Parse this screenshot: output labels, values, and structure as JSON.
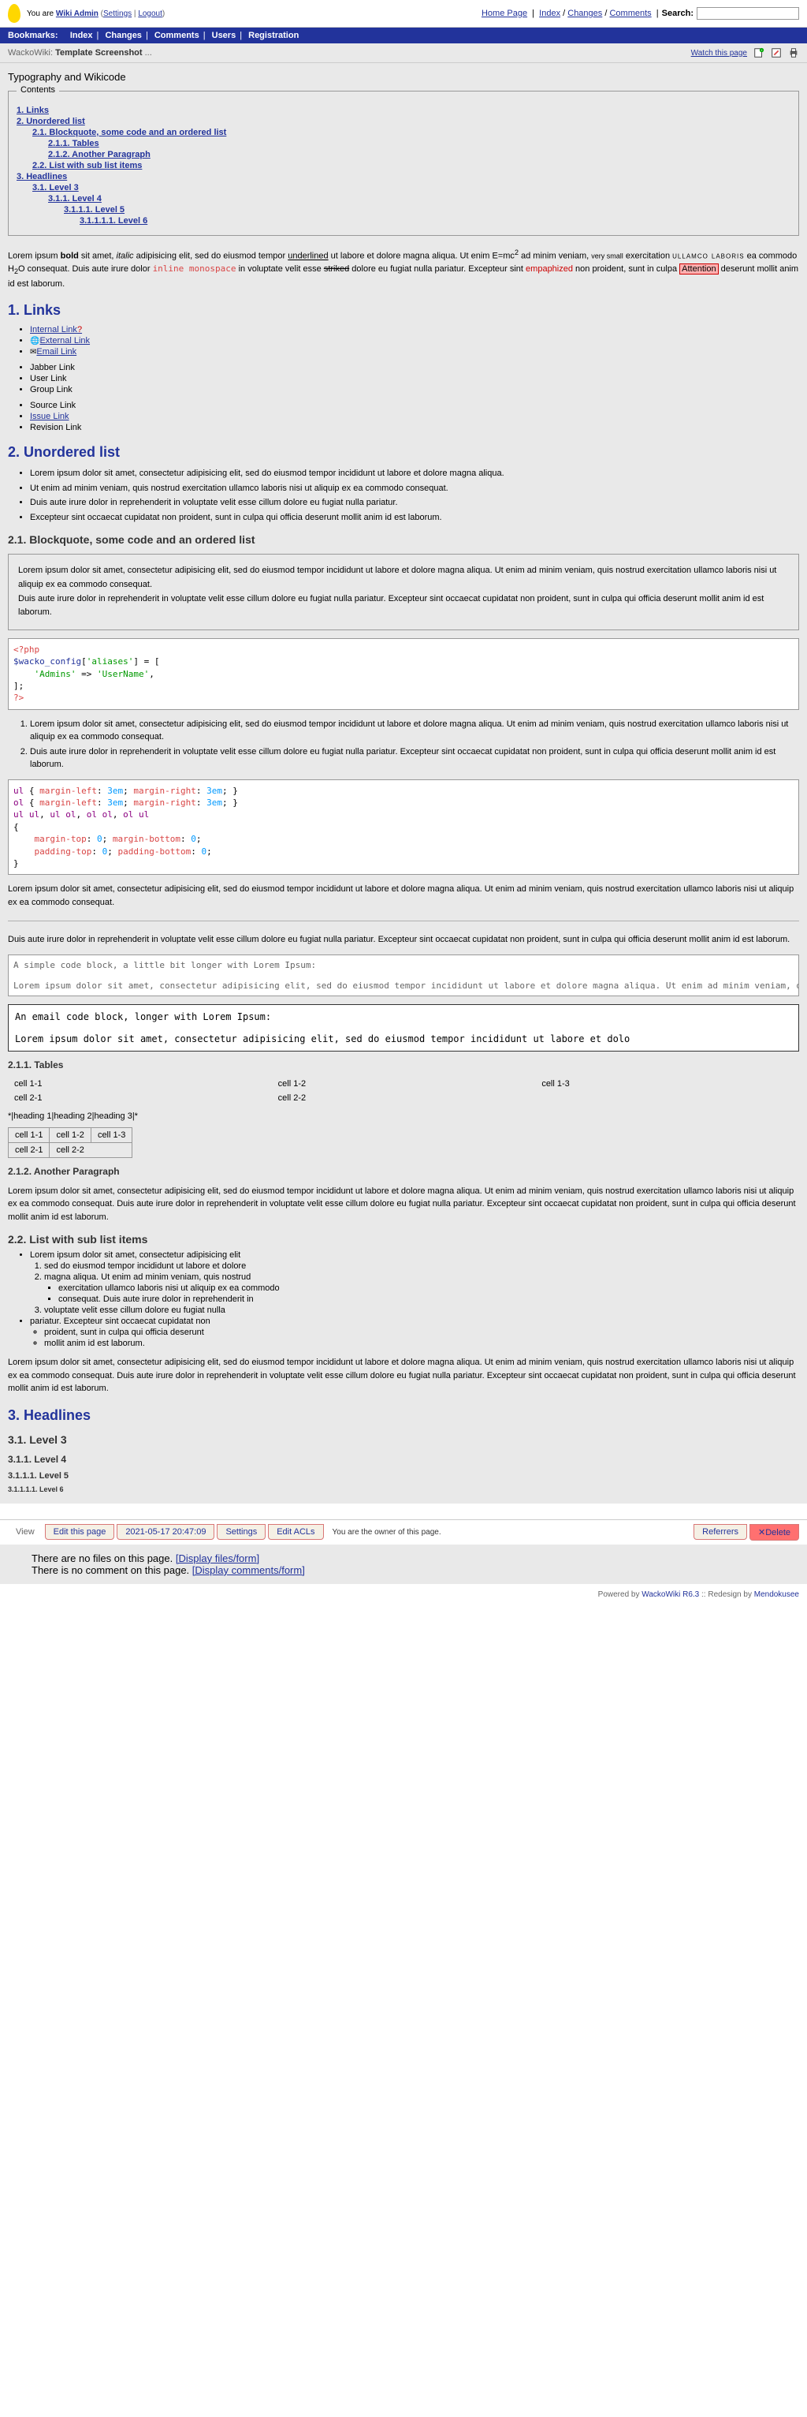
{
  "header": {
    "user_prefix": "You are",
    "user_name": "Wiki Admin",
    "account": "Settings",
    "logout": "Logout",
    "home": "Home Page",
    "index": "Index",
    "changes": "Changes",
    "comments": "Comments",
    "search_label": "Search:"
  },
  "bookmarks": {
    "label": "Bookmarks:",
    "items": [
      "Index",
      "Changes",
      "Comments",
      "Users",
      "Registration"
    ]
  },
  "page": {
    "wiki_name": "WackoWiki:",
    "title": "Template Screenshot",
    "dots": "...",
    "watch": "Watch this page",
    "heading": "Typography and Wikicode"
  },
  "toc": {
    "legend": "Contents",
    "l1": "1. Links",
    "l2": "2. Unordered list",
    "l21": "2.1. Blockquote, some code and an ordered list",
    "l211": "2.1.1. Tables",
    "l212": "2.1.2. Another Paragraph",
    "l22": "2.2. List with sub list items",
    "l3": "3. Headlines",
    "l31": "3.1. Level 3",
    "l311": "3.1.1. Level 4",
    "l3111": "3.1.1.1. Level 5",
    "l31111": "3.1.1.1.1. Level 6"
  },
  "intro": {
    "p1": "Lorem ipsum ",
    "bold": "bold",
    "p2": " sit amet, ",
    "italic": "italic",
    "p3": " adipisicing elit, sed do eiusmod tempor ",
    "underline": "underlined",
    "p4": " ut labore et dolore magna aliqua. Ut enim E=mc",
    "sup": "2",
    "p5": " ad minim veniam, ",
    "small": "very small",
    "p6": " exercitation ",
    "caps": "ullamco laboris",
    "p7": " ea commodo H",
    "sub": "2",
    "p8": "O consequat. Duis aute irure dolor ",
    "mono": "inline monospace",
    "p9": " in voluptate velit esse ",
    "strike": "striked",
    "p10": " dolore eu fugiat nulla pariatur. Excepteur sint ",
    "red": "empaphized",
    "p11": " non proident, sunt in culpa ",
    "highlight": "Attention",
    "p12": " deserunt mollit anim id est laborum."
  },
  "sections": {
    "links": "1. Links",
    "unordered": "2. Unordered list",
    "blockquote": "2.1. Blockquote, some code and an ordered list",
    "tables": "2.1.1. Tables",
    "another": "2.1.2. Another Paragraph",
    "sublist": "2.2. List with sub list items",
    "headlines": "3. Headlines",
    "level3": "3.1. Level 3",
    "level4": "3.1.1. Level 4",
    "level5": "3.1.1.1. Level 5",
    "level6": "3.1.1.1.1. Level 6"
  },
  "links": {
    "internal": "Internal Link",
    "external": "External Link",
    "email": "Email Link",
    "jabber": "Jabber Link",
    "user": "User Link",
    "group": "Group Link",
    "source": "Source Link",
    "issue": "Issue Link",
    "revision": "Revision Link"
  },
  "ul_items": {
    "i1": "Lorem ipsum dolor sit amet, consectetur adipisicing elit, sed do eiusmod tempor incididunt ut labore et dolore magna aliqua.",
    "i2": "Ut enim ad minim veniam, quis nostrud exercitation ullamco laboris nisi ut aliquip ex ea commodo consequat.",
    "i3": "Duis aute irure dolor in reprehenderit in voluptate velit esse cillum dolore eu fugiat nulla pariatur.",
    "i4": "Excepteur sint occaecat cupidatat non proident, sunt in culpa qui officia deserunt mollit anim id est laborum."
  },
  "blockquote": {
    "p1": "Lorem ipsum dolor sit amet, consectetur adipisicing elit, sed do eiusmod tempor incididunt ut labore et dolore magna aliqua. Ut enim ad minim veniam, quis nostrud exercitation ullamco laboris nisi ut aliquip ex ea commodo consequat.",
    "p2": "Duis aute irure dolor in reprehenderit in voluptate velit esse cillum dolore eu fugiat nulla pariatur. Excepteur sint occaecat cupidatat non proident, sunt in culpa qui officia deserunt mollit anim id est laborum."
  },
  "code1": "<?php\n$wacko_config['aliases'] = [\n    'Admins' => 'UserName',\n];\n?>",
  "ol_items": {
    "i1": "Lorem ipsum dolor sit amet, consectetur adipisicing elit, sed do eiusmod tempor incididunt ut labore et dolore magna aliqua. Ut enim ad minim veniam, quis nostrud exercitation ullamco laboris nisi ut aliquip ex ea commodo consequat.",
    "i2": "Duis aute irure dolor in reprehenderit in voluptate velit esse cillum dolore eu fugiat nulla pariatur. Excepteur sint occaecat cupidatat non proident, sunt in culpa qui officia deserunt mollit anim id est laborum."
  },
  "code2": "ul { margin-left: 3em; margin-right: 3em; }\nol { margin-left: 3em; margin-right: 3em; }\nul ul, ul ol, ol ol, ol ul\n{\n    margin-top: 0; margin-bottom: 0;\n    padding-top: 0; padding-bottom: 0;\n}",
  "para_after_code": "Lorem ipsum dolor sit amet, consectetur adipisicing elit, sed do eiusmod tempor incididunt ut labore et dolore magna aliqua. Ut enim ad minim veniam, quis nostrud exercitation ullamco laboris nisi ut aliquip ex ea commodo consequat.",
  "para_after_hr": "Duis aute irure dolor in reprehenderit in voluptate velit esse cillum dolore eu fugiat nulla pariatur. Excepteur sint occaecat cupidatat non proident, sunt in culpa qui officia deserunt mollit anim id est laborum.",
  "simple_code": {
    "l1": "A simple code block, a little bit longer with Lorem Ipsum:",
    "l2": "Lorem ipsum dolor sit amet, consectetur adipisicing elit, sed do eiusmod tempor incididunt ut labore et dolore magna aliqua. Ut enim ad minim veniam, quis nostrud exercitation ullamco laboris nisi ut aliquip ex ea commodo"
  },
  "email_code": {
    "l1": "An email code block, longer with Lorem Ipsum:",
    "l2": "Lorem ipsum dolor sit amet, consectetur adipisicing elit, sed do eiusmod tempor incididunt ut labore et dolo"
  },
  "table1": {
    "r1c1": "cell 1-1",
    "r1c2": "cell 1-2",
    "r1c3": "cell 1-3",
    "r2c1": "cell 2-1",
    "r2c2": "cell 2-2"
  },
  "table2_markup": "*|heading 1|heading 2|heading 3|*",
  "table2": {
    "r1c1": "cell 1-1",
    "r1c2": "cell 1-2",
    "r1c3": "cell 1-3",
    "r2c1": "cell 2-1",
    "r2c2": "cell 2-2"
  },
  "another_para": "Lorem ipsum dolor sit amet, consectetur adipisicing elit, sed do eiusmod tempor incididunt ut labore et dolore magna aliqua. Ut enim ad minim veniam, quis nostrud exercitation ullamco laboris nisi ut aliquip ex ea commodo consequat. Duis aute irure dolor in reprehenderit in voluptate velit esse cillum dolore eu fugiat nulla pariatur. Excepteur sint occaecat cupidatat non proident, sunt in culpa qui officia deserunt mollit anim id est laborum.",
  "nested": {
    "i1": "Lorem ipsum dolor sit amet, consectetur adipisicing elit",
    "i1_1": "sed do eiusmod tempor incididunt ut labore et dolore",
    "i1_2": "magna aliqua. Ut enim ad minim veniam, quis nostrud",
    "i1_2_1": "exercitation ullamco laboris nisi ut aliquip ex ea commodo",
    "i1_2_2": "consequat. Duis aute irure dolor in reprehenderit in",
    "i1_3": "voluptate velit esse cillum dolore eu fugiat nulla",
    "i2": "pariatur. Excepteur sint occaecat cupidatat non",
    "i2_1": "proident, sunt in culpa qui officia deserunt",
    "i2_2": "mollit anim id est laborum."
  },
  "final_para": "Lorem ipsum dolor sit amet, consectetur adipisicing elit, sed do eiusmod tempor incididunt ut labore et dolore magna aliqua. Ut enim ad minim veniam, quis nostrud exercitation ullamco laboris nisi ut aliquip ex ea commodo consequat. Duis aute irure dolor in reprehenderit in voluptate velit esse cillum dolore eu fugiat nulla pariatur. Excepteur sint occaecat cupidatat non proident, sunt in culpa qui officia deserunt mollit anim id est laborum.",
  "footer": {
    "view": "View",
    "edit": "Edit this page",
    "date": "2021-05-17 20:47:09",
    "settings": "Settings",
    "acls": "Edit ACLs",
    "owner": "You are the owner of this page.",
    "referrers": "Referrers",
    "delete": "Delete",
    "files": "There are no files on this page.",
    "files_link": "[Display files/form]",
    "comments": "There is no comment on this page.",
    "comments_link": "[Display comments/form]"
  },
  "powered": {
    "text": "Powered by ",
    "wacko": "WackoWiki R6.3",
    "redesign": " :: Redesign by ",
    "author": "Mendokusee"
  }
}
